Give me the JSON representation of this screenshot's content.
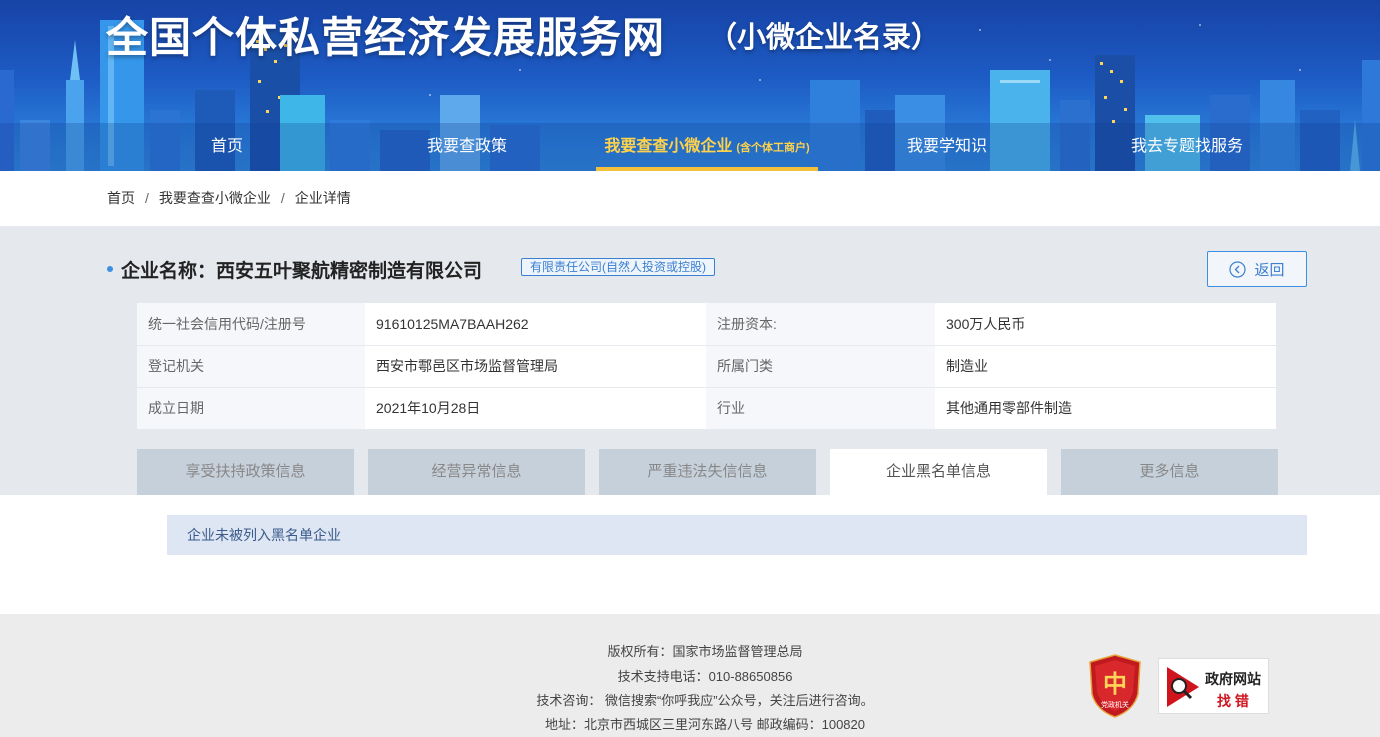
{
  "header": {
    "title": "全国个体私营经济发展服务网",
    "subtitle": "（小微企业名录）"
  },
  "nav": {
    "items": [
      {
        "label": "首页"
      },
      {
        "label": "我要查政策"
      },
      {
        "label": "我要查查小微企业",
        "note": "(含个体工商户)"
      },
      {
        "label": "我要学知识"
      },
      {
        "label": "我去专题找服务"
      }
    ],
    "active_index": 2
  },
  "breadcrumb": {
    "items": [
      "首页",
      "我要查查小微企业",
      "企业详情"
    ],
    "separator": "/"
  },
  "company": {
    "name_label": "企业名称：",
    "name": "西安五叶聚航精密制造有限公司",
    "type": "有限责任公司(自然人投资或控股)"
  },
  "back_button": {
    "label": "返回",
    "icon": "back-arrow-circle-icon"
  },
  "info": {
    "rows": [
      {
        "label1": "统一社会信用代码/注册号",
        "value1": "91610125MA7BAAH262",
        "label2": "注册资本:",
        "value2": "300万人民币"
      },
      {
        "label1": "登记机关",
        "value1": "西安市鄠邑区市场监督管理局",
        "label2": "所属门类",
        "value2": "制造业"
      },
      {
        "label1": "成立日期",
        "value1": "2021年10月28日",
        "label2": "行业",
        "value2": "其他通用零部件制造"
      }
    ]
  },
  "tabs": {
    "items": [
      "享受扶持政策信息",
      "经营异常信息",
      "严重违法失信信息",
      "企业黑名单信息",
      "更多信息"
    ],
    "active_index": 3
  },
  "result": {
    "text": "企业未被列入黑名单企业"
  },
  "footer": {
    "copyright": "版权所有：国家市场监督管理总局",
    "phone": "技术支持电话：010-88650856",
    "consult": "技术咨询：  微信搜索“你呼我应”公众号，关注后进行咨询。",
    "address": "地址：北京市西城区三里河东路八号 邮政编码：100820",
    "emblem_text": "党政机关",
    "gov_badge_line1": "政府网站",
    "gov_badge_line2": "找 错"
  },
  "colors": {
    "header_blue": "#1d5bc4",
    "nav_active": "#ffd24a",
    "accent_blue": "#3b8ee0",
    "panel_grey": "#e5e9ee",
    "tab_inactive": "#c6d0db",
    "emblem_red": "#c0191f"
  }
}
